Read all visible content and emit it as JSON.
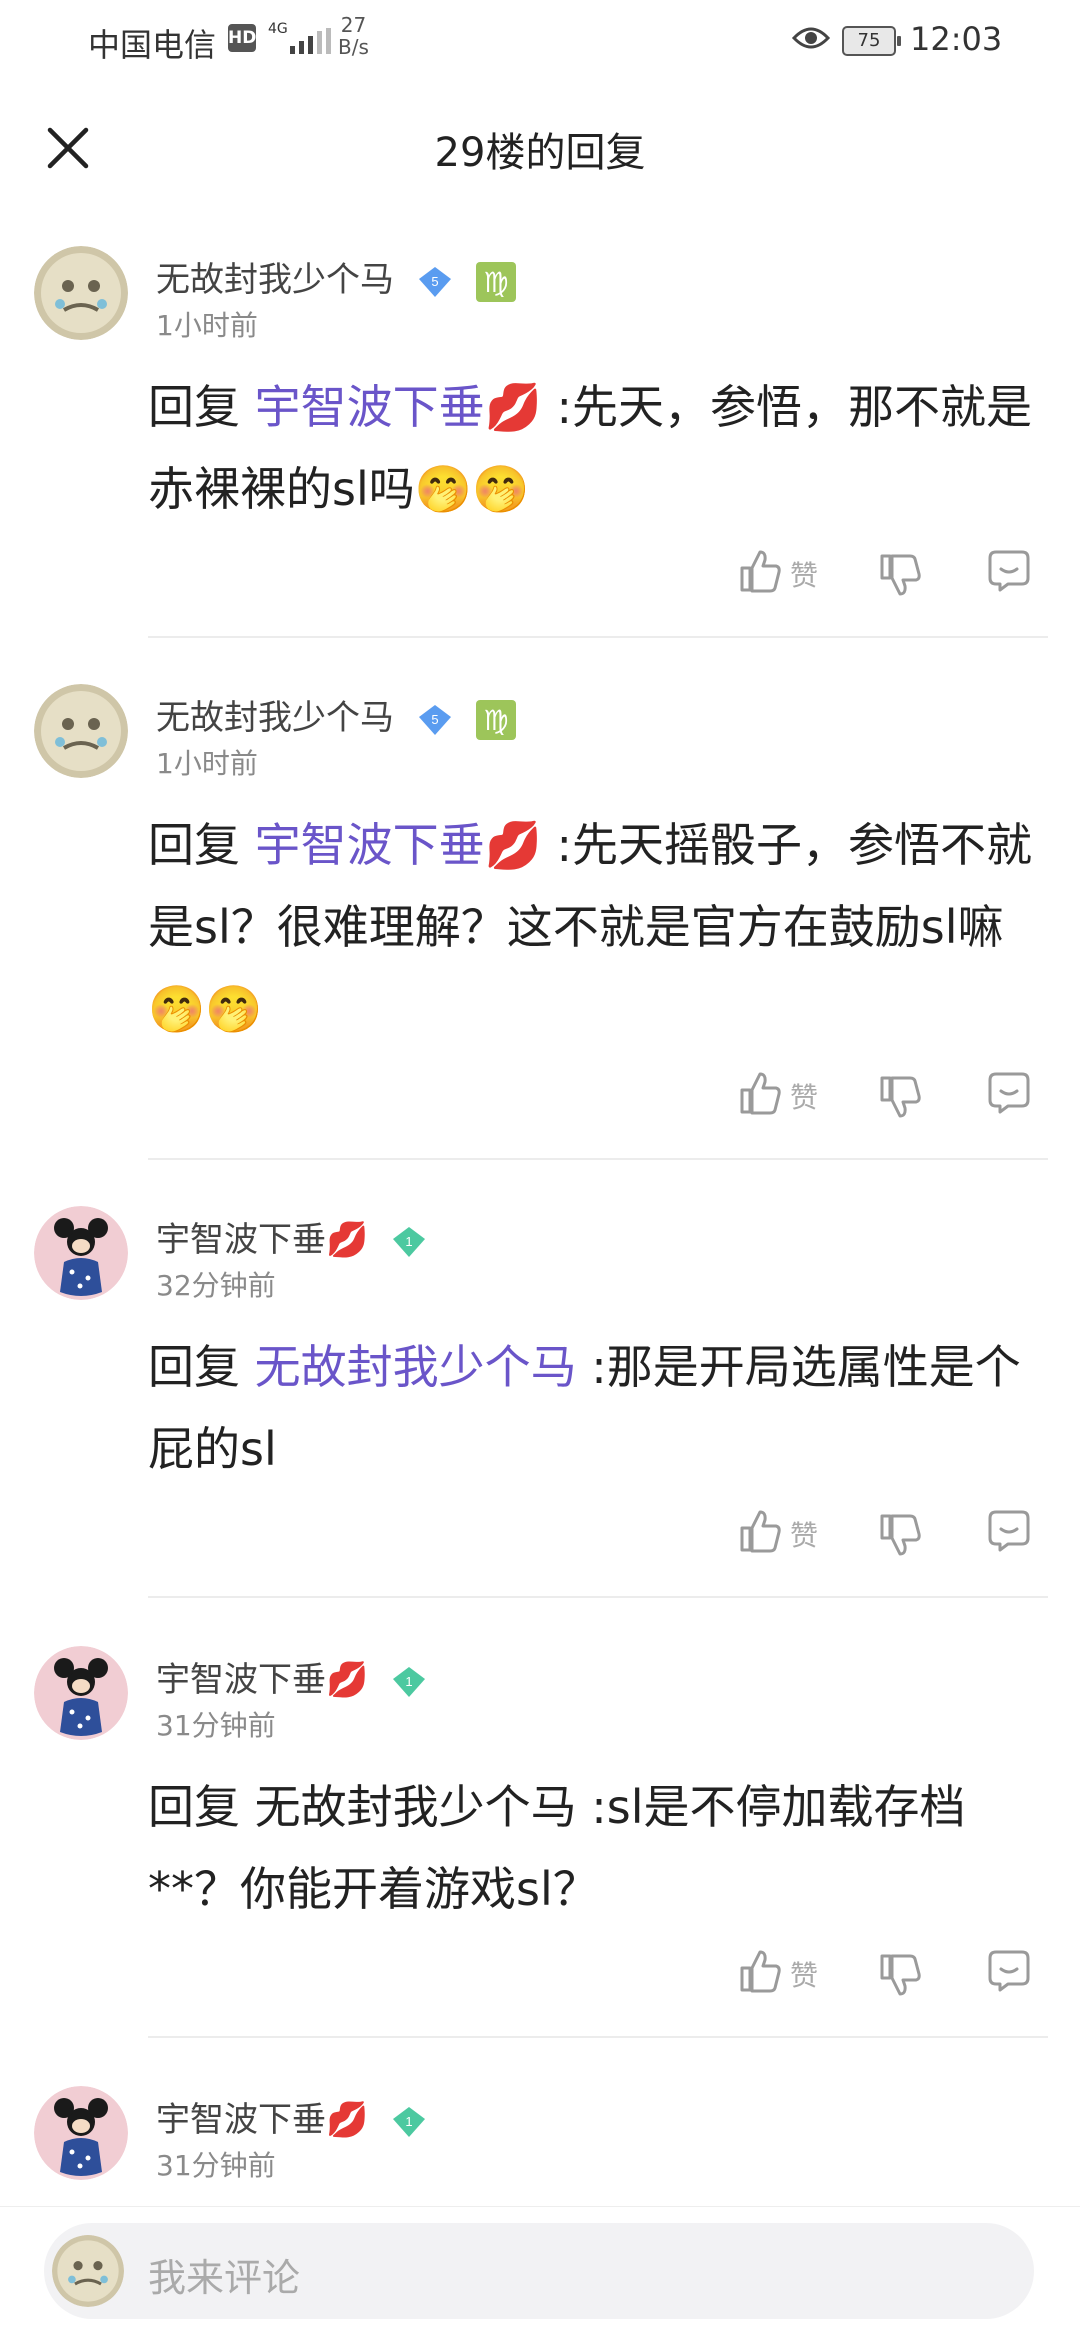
{
  "status_bar": {
    "carrier": "中国电信",
    "hd": "HD",
    "network": "4G",
    "speed_value": "27",
    "speed_unit": "B/s",
    "battery": "75",
    "time": "12:03"
  },
  "header": {
    "title": "29楼的回复"
  },
  "comments": [
    {
      "username": "无故封我少个马",
      "level": "5",
      "time": "1小时前",
      "prefix": "回复 ",
      "mention": "宇智波下垂💋",
      "text": " :先天，参悟，那不就是赤裸裸的sl吗🤭🤭",
      "like_label": "赞"
    },
    {
      "username": "无故封我少个马",
      "level": "5",
      "time": "1小时前",
      "prefix": "回复 ",
      "mention": "宇智波下垂💋",
      "text": " :先天摇骰子，参悟不就是sl？很难理解？这不就是官方在鼓励sl嘛🤭🤭",
      "like_label": "赞"
    },
    {
      "username": "宇智波下垂💋",
      "level": "1",
      "time": "32分钟前",
      "prefix": "回复 ",
      "mention": "无故封我少个马",
      "text": " :那是开局选属性是个屁的sl",
      "like_label": "赞"
    },
    {
      "username": "宇智波下垂💋",
      "level": "1",
      "time": "31分钟前",
      "prefix": "回复 ",
      "mention": "",
      "text": "无故封我少个马 :sl是不停加载存档 **？你能开着游戏sl？",
      "like_label": "赞"
    },
    {
      "username": "宇智波下垂💋",
      "level": "1",
      "time": "31分钟前"
    }
  ],
  "bottom": {
    "placeholder": "我来评论"
  },
  "colors": {
    "mention": "#6a55c9",
    "gem_blue": "#5a9cf0",
    "gem_green": "#4cc9a0",
    "virgo": "#9dc55a"
  }
}
